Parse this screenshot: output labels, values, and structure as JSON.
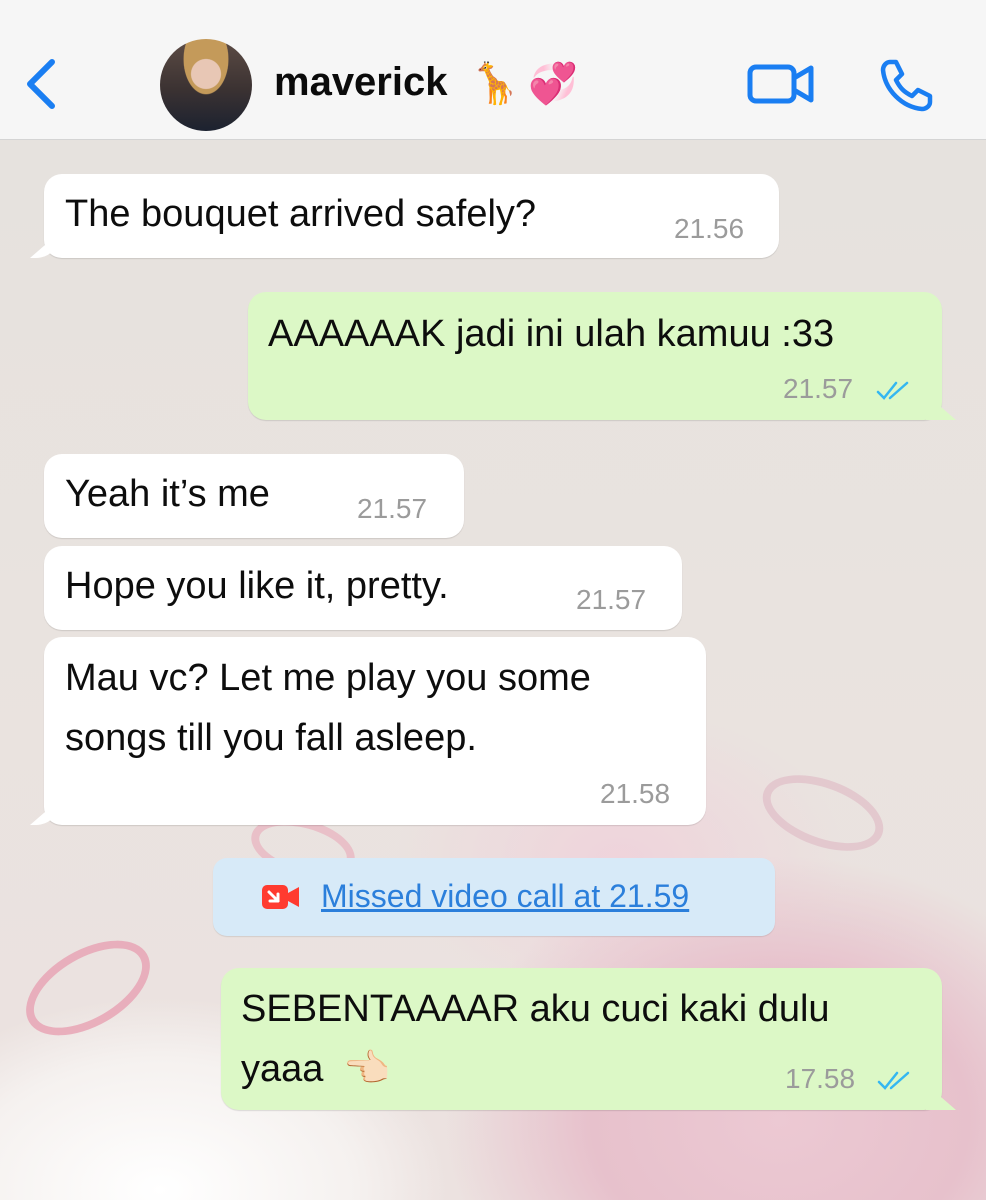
{
  "header": {
    "back_icon": "chevron-left-icon",
    "contact_name": "maverick",
    "name_emoji_1": "🦒",
    "name_emoji_2": "💞",
    "video_icon": "video-camera-icon",
    "call_icon": "phone-icon",
    "accent_color": "#1a7ef2"
  },
  "messages": [
    {
      "direction": "incoming",
      "text": "The bouquet arrived safely?",
      "time": "21.56"
    },
    {
      "direction": "outgoing",
      "text": "AAAAAAK jadi ini ulah kamuu :33",
      "time": "21.57",
      "status": "read"
    },
    {
      "direction": "incoming",
      "text": "Yeah it’s me",
      "time": "21.57"
    },
    {
      "direction": "incoming",
      "text": "Hope you like it, pretty.",
      "time": "21.57"
    },
    {
      "direction": "incoming",
      "text_line1": "Mau vc? Let me play you some",
      "text_line2": "songs till you fall asleep.",
      "time": "21.58"
    },
    {
      "direction": "outgoing",
      "text_line1": "SEBENTAAAAR aku cuci kaki dulu",
      "text_line2": "yaaa",
      "emoji": "👈🏻",
      "time": "17.58",
      "status": "read"
    }
  ],
  "missed_call": {
    "icon": "missed-video-call-icon",
    "text": "Missed video call at 21.59"
  },
  "colors": {
    "incoming_bubble": "#ffffff",
    "outgoing_bubble": "#dcf8c6",
    "read_ticks": "#34b7f1",
    "missed_call_bg": "#d7eaf8"
  }
}
